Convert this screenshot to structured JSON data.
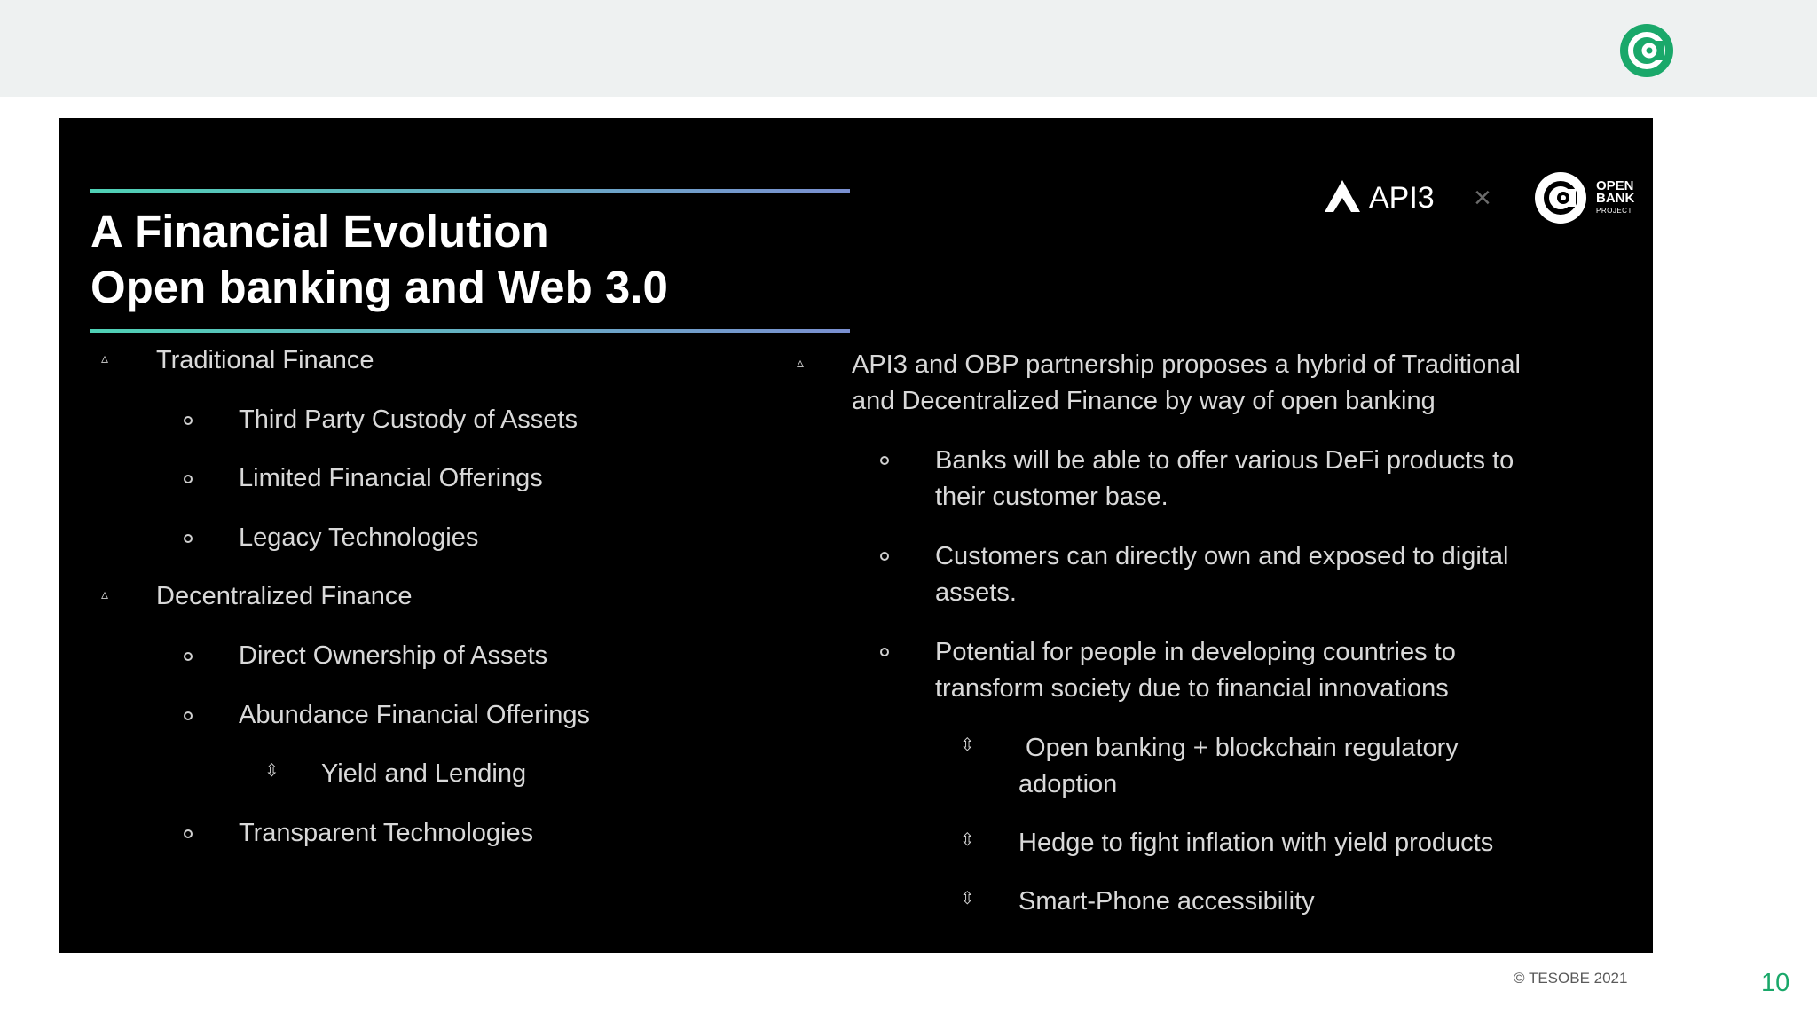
{
  "slide": {
    "title_line1": "A Financial Evolution",
    "title_line2": "Open banking and Web 3.0"
  },
  "logos": {
    "partner1": "API3",
    "partner2_line1": "OPEN",
    "partner2_line2": "BANK",
    "partner2_line3": "PROJECT",
    "separator": "×"
  },
  "left": {
    "traditional": {
      "label": "Traditional Finance",
      "items": [
        "Third Party Custody of Assets",
        "Limited Financial Offerings",
        "Legacy Technologies"
      ]
    },
    "decentralized": {
      "label": "Decentralized Finance",
      "items": [
        "Direct Ownership of Assets",
        "Abundance Financial Offerings",
        "Transparent Technologies"
      ],
      "subitem": "Yield and Lending"
    }
  },
  "right": {
    "intro_line1": "API3 and OBP partnership proposes a hybrid of Traditional",
    "intro_line2": "and Decentralized Finance by way of open banking",
    "points": [
      {
        "line1": "Banks will be able to offer various DeFi products to",
        "line2": "their customer base."
      },
      {
        "line1": "Customers can directly own and exposed to digital",
        "line2": "assets."
      },
      {
        "line1": "Potential for people in developing countries to",
        "line2": "transform society due to financial innovations"
      }
    ],
    "subpoints": [
      {
        "line1": " Open banking + blockchain regulatory",
        "line2": "adoption"
      },
      {
        "line1": "Hedge to fight inflation with yield products"
      },
      {
        "line1": "Smart-Phone accessibility"
      }
    ]
  },
  "footer": {
    "copyright": "© TESOBE 2021",
    "page_number": "10"
  },
  "colors": {
    "accent_green": "#1aa86a",
    "slide_background": "#000000",
    "rule_gradient_start": "#4fd1b5",
    "rule_gradient_end": "#7a8fd0"
  },
  "icons": {
    "brand": "open-bank-project-logo-icon",
    "bullet_level1": "triangle-bullet-icon",
    "bullet_level2": "circle-bullet-icon",
    "bullet_level3": "diamond-arrow-bullet-icon"
  }
}
